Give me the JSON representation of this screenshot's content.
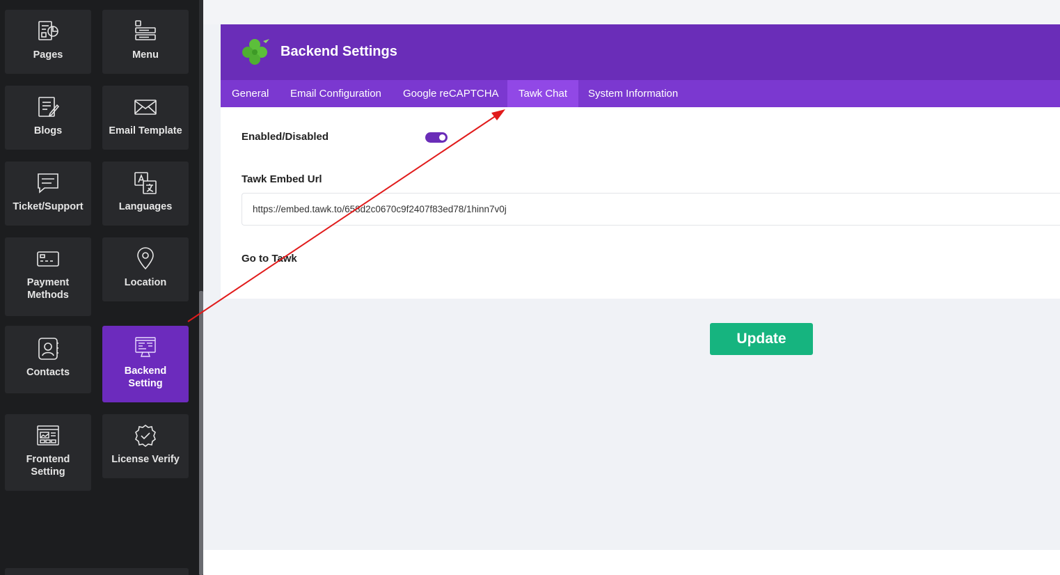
{
  "sidebar": {
    "items": [
      {
        "label": "Pages",
        "icon": "pages-icon"
      },
      {
        "label": "Menu",
        "icon": "menu-icon"
      },
      {
        "label": "Blogs",
        "icon": "blogs-icon"
      },
      {
        "label": "Email Template",
        "icon": "envelope-icon"
      },
      {
        "label": "Ticket/Support",
        "icon": "chat-icon"
      },
      {
        "label": "Languages",
        "icon": "translate-icon"
      },
      {
        "label": "Payment\nMethods",
        "icon": "card-icon"
      },
      {
        "label": "Location",
        "icon": "map-pin-icon"
      },
      {
        "label": "Contacts",
        "icon": "contact-icon"
      },
      {
        "label": "Backend\nSetting",
        "icon": "monitor-code-icon",
        "active": true
      },
      {
        "label": "Frontend\nSetting",
        "icon": "frontend-icon"
      },
      {
        "label": "License Verify",
        "icon": "badge-check-icon"
      }
    ]
  },
  "header": {
    "title": "Backend Settings",
    "logo": "clover-logo-icon"
  },
  "tabs": [
    {
      "label": "General"
    },
    {
      "label": "Email Configuration"
    },
    {
      "label": "Google reCAPTCHA"
    },
    {
      "label": "Tawk Chat",
      "active": true
    },
    {
      "label": "System Information"
    }
  ],
  "form": {
    "enabled_label": "Enabled/Disabled",
    "enabled": true,
    "embed_url_label": "Tawk Embed Url",
    "embed_url_value": "https://embed.tawk.to/658d2c0670c9f2407f83ed78/1hinn7v0j",
    "go_link_label": "Go to Tawk"
  },
  "actions": {
    "update_label": "Update"
  },
  "colors": {
    "accent": "#6a2db8",
    "tab_bar": "#7b38d0",
    "tab_active": "#9148e6",
    "update_button": "#16b47f",
    "annotation_arrow": "#e11b1b"
  }
}
